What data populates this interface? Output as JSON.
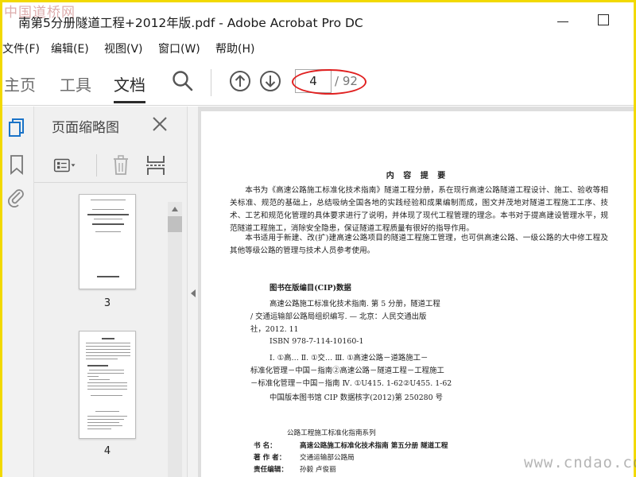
{
  "watermark": {
    "top_left": "中国道桥网",
    "bottom_right": "www.cndao.com"
  },
  "window": {
    "title": "南第5分册隧道工程+2012年版.pdf - Adobe Acrobat Pro DC"
  },
  "menu": [
    "文件(F)",
    "编辑(E)",
    "视图(V)",
    "窗口(W)",
    "帮助(H)"
  ],
  "toolbar": {
    "tabs": [
      "主页",
      "工具",
      "文档"
    ],
    "active_tab": "文档",
    "current_page": "4",
    "total_pages": "/ 92",
    "annotation_color": "#e02020"
  },
  "thumbnail_panel": {
    "title": "页面缩略图",
    "pages": [
      {
        "label": "3"
      },
      {
        "label": "4"
      }
    ]
  },
  "document": {
    "heading": "内 容 提 要",
    "paragraphs": [
      "本书为《高速公路施工标准化技术指南》隧道工程分册，系在现行高速公路隧道工程设计、施工、验收等相关标准、规范的基础上，总结吸纳全国各地的实践经验和成果编制而成，图文并茂地对隧道工程施工工序、技术、工艺和规范化管理的具体要求进行了说明，并体现了现代工程管理的理念。本书对于提高建设管理水平，规范隧道工程施工，消除安全隐患，保证隧道工程质量有很好的指导作用。",
      "本书适用于新建、改(扩)建高速公路项目的隧道工程施工管理，也可供高速公路、一级公路的大中修工程及其他等级公路的管理与技术人员参考使用。"
    ],
    "cip_title": "图书在版编目(CIP)数据",
    "cip_lines": [
      "高速公路施工标准化技术指南. 第 5 分册，隧道工程",
      "/ 交通运输部公路局组织编写. — 北京：人民交通出版",
      "社，2012. 11",
      "ISBN 978-7-114-10160-1",
      "Ⅰ. ①高…   Ⅱ. ①交…   Ⅲ. ①高速公路－道路施工－",
      "标准化管理－中国－指南②高速公路－隧道工程－工程施工",
      "－标准化管理－中国－指南   Ⅳ. ①U415. 1-62②U455. 1-62",
      "中国版本图书馆 CIP 数据核字(2012)第 250280 号"
    ],
    "series": "公路工程施工标准化指南系列",
    "book_name_label": "书     名：",
    "book_name": "高速公路施工标准化技术指南   第五分册   隧道工程",
    "author_label": "著 作 者：",
    "author": "交通运输部公路局",
    "editor_label": "责任编辑：",
    "editor": "孙毅   卢俊丽"
  }
}
